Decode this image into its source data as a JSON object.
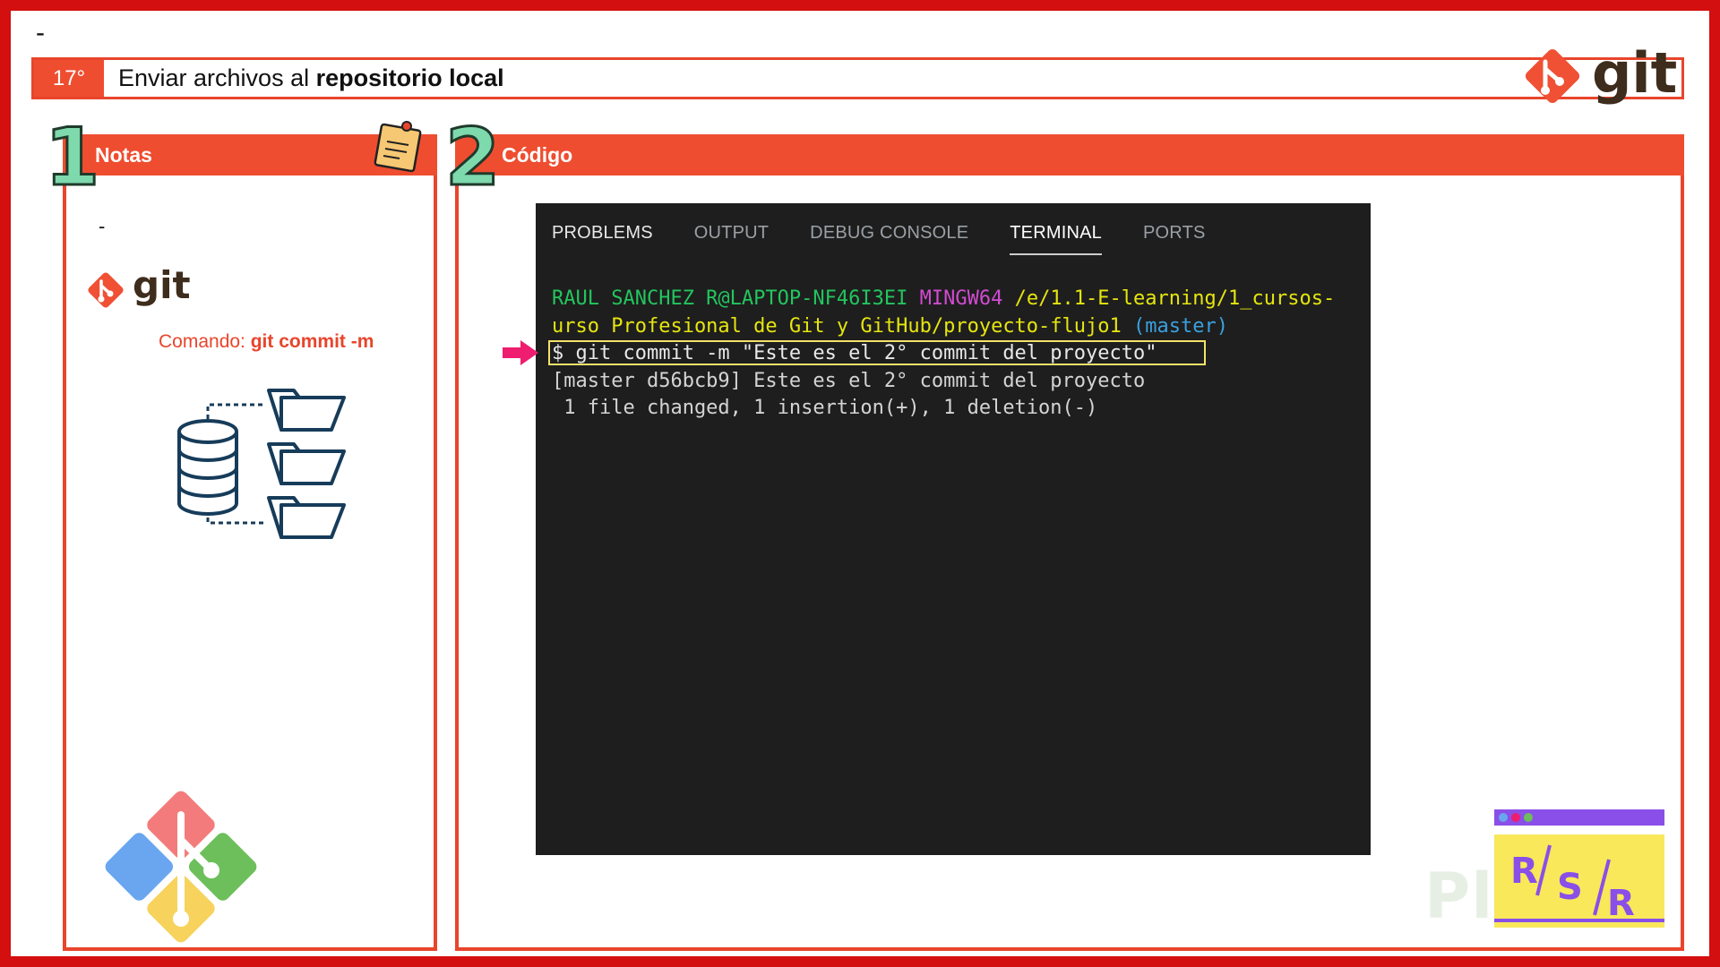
{
  "top_dash": "-",
  "title": {
    "number": "17°",
    "text_plain": "Enviar archivos al ",
    "text_bold": "repositorio local"
  },
  "brand": {
    "git_word": "git"
  },
  "notes": {
    "number": "1",
    "header": "Notas",
    "dash": "-",
    "git_word": "git",
    "comando_label": "Comando: ",
    "comando_value": "git commit -m"
  },
  "code": {
    "number": "2",
    "header": "Código"
  },
  "terminal": {
    "tabs": [
      {
        "label": "PROBLEMS",
        "active": false
      },
      {
        "label": "OUTPUT",
        "active": false
      },
      {
        "label": "DEBUG CONSOLE",
        "active": false
      },
      {
        "label": "TERMINAL",
        "active": true
      },
      {
        "label": "PORTS",
        "active": false
      }
    ],
    "prompt_user": "RAUL SANCHEZ R@LAPTOP-NF46I3EI",
    "prompt_env": "MINGW64",
    "prompt_path_1": "/e/1.1-E-learning/1_cursos-",
    "prompt_path_2": "urso Profesional de Git y GitHub/proyecto-flujo1",
    "prompt_branch": "(master)",
    "command": "$ git commit -m \"Este es el 2° commit del proyecto\"",
    "output_1": "[master d56bcb9] Este es el 2° commit del proyecto",
    "output_2": " 1 file changed, 1 insertion(+), 1 deletion(-)"
  },
  "badge": {
    "letters": [
      "R",
      "S",
      "R"
    ]
  },
  "watermark": "Platzi",
  "colors": {
    "accent": "#ef4d30",
    "frame": "#d30f0f",
    "git_brand": "#f05033",
    "terminal_bg": "#1e1e1e"
  }
}
